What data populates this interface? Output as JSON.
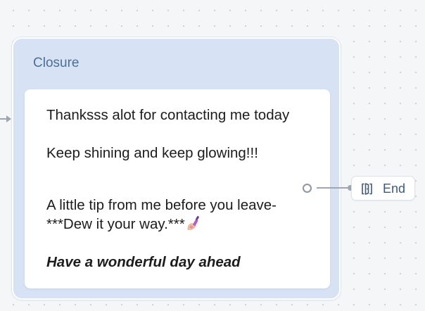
{
  "node": {
    "title": "Closure",
    "messages": [
      "Thanksss alot for contacting me today",
      "Keep shining and keep glowing!!!",
      "A little tip from me before you leave- ***Dew it your way.***",
      "Have a wonderful day ahead"
    ],
    "emoji_icon": "nail-polish-emoji"
  },
  "end_node": {
    "label": "End",
    "icon": "exit-door-icon"
  },
  "colors": {
    "node_background": "#d7e3f4",
    "card_background": "#ffffff",
    "title_color": "#4c6f96",
    "end_label_color": "#3c5a7c",
    "connector_color": "#9ea6b2"
  }
}
